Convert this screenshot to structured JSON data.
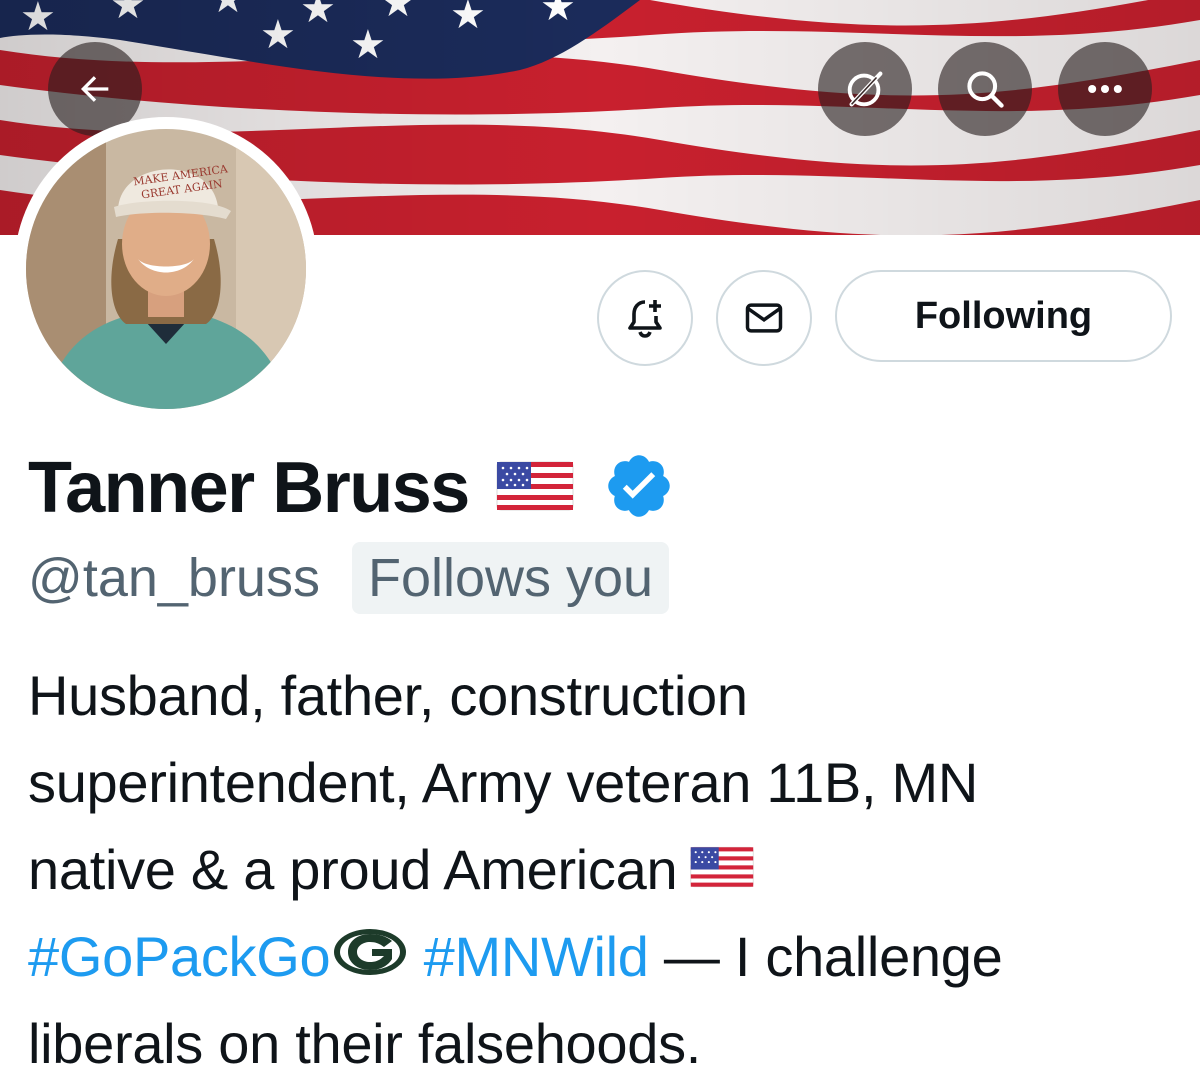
{
  "header": {
    "banner_image": "american-flag-banner",
    "back_icon": "arrow-left-icon",
    "grok_icon": "grok-icon",
    "search_icon": "search-icon",
    "more_icon": "more-dots-icon"
  },
  "profile": {
    "avatar": "profile-photo",
    "name": "Tanner Bruss",
    "name_emoji": "us-flag-emoji",
    "verified": true,
    "handle": "@tan_bruss",
    "follows_you_label": "Follows you"
  },
  "actions": {
    "notify_icon": "bell-plus-icon",
    "message_icon": "envelope-icon",
    "following_label": "Following"
  },
  "bio": {
    "line1": "Husband, father, construction",
    "line2": "superintendent, Army veteran 11B, MN",
    "line3_text": "native & a proud American",
    "hashtag1": "#GoPackGo",
    "hashtag2": "#MNWild",
    "line4_text": " — I challenge",
    "line5": "liberals on their falsehoods."
  },
  "colors": {
    "link": "#1d9bf0",
    "verified": "#1d9bf0",
    "secondary_text": "#536471",
    "border": "#cfd9de"
  }
}
